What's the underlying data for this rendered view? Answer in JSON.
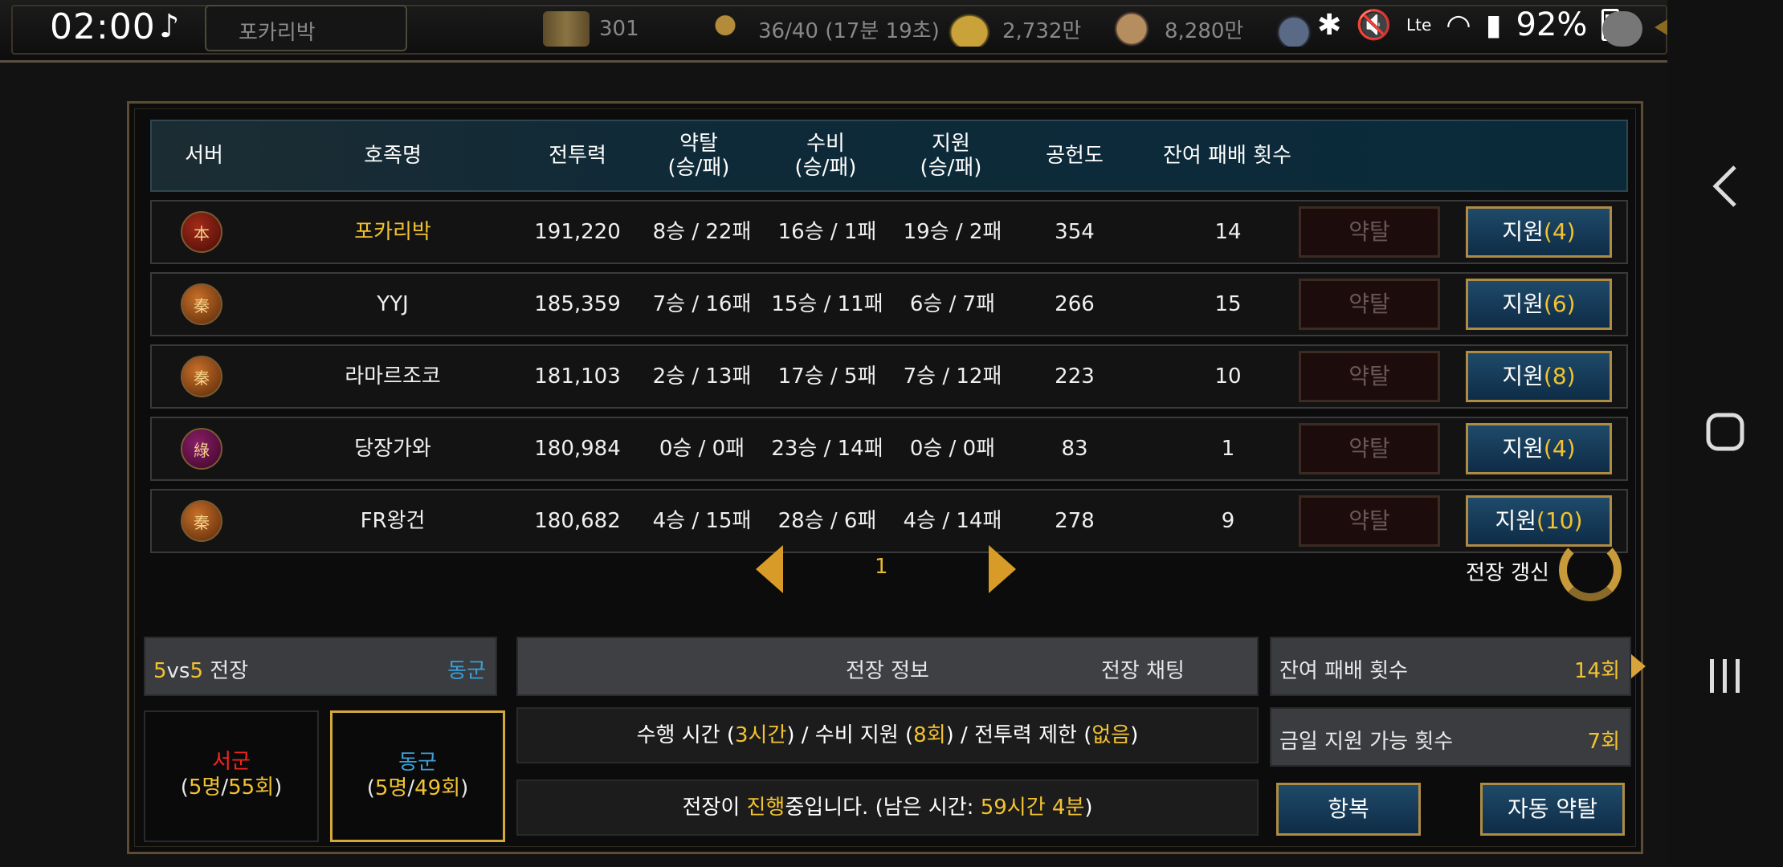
{
  "status": {
    "time": "02:00",
    "music_icon": "music-note-icon",
    "battery": "92%"
  },
  "topbar": {
    "player_name": "포카리박",
    "resources": [
      {
        "icon": "scroll-icon",
        "value": "301"
      },
      {
        "icon": "runner-icon",
        "value": "36/40 (17분 19초)"
      },
      {
        "icon": "gold-icon",
        "value": "2,732만"
      },
      {
        "icon": "food-icon",
        "value": "8,280만"
      }
    ]
  },
  "table": {
    "headers": {
      "server": "서버",
      "clan": "호족명",
      "power": "전투력",
      "raid_top": "약탈",
      "raid_bot": "(승/패)",
      "defend_top": "수비",
      "defend_bot": "(승/패)",
      "support_top": "지원",
      "support_bot": "(승/패)",
      "contribution": "공헌도",
      "remaining": "잔여 패배 횟수"
    },
    "raid_label": "약탈",
    "support_label": "지원",
    "rows": [
      {
        "emblem": "本",
        "emblem_color": "red",
        "name": "포카리박",
        "highlight": true,
        "power": "191,220",
        "raid": "8승 / 22패",
        "defend": "16승 / 1패",
        "support": "19승 / 2패",
        "contribution": "354",
        "remaining": "14",
        "support_count": "(4)"
      },
      {
        "emblem": "秦",
        "emblem_color": "orange",
        "name": "YYJ",
        "highlight": false,
        "power": "185,359",
        "raid": "7승 / 16패",
        "defend": "15승 / 11패",
        "support": "6승 / 7패",
        "contribution": "266",
        "remaining": "15",
        "support_count": "(6)"
      },
      {
        "emblem": "秦",
        "emblem_color": "orange",
        "name": "라마르조코",
        "highlight": false,
        "power": "181,103",
        "raid": "2승 / 13패",
        "defend": "17승 / 5패",
        "support": "7승 / 12패",
        "contribution": "223",
        "remaining": "10",
        "support_count": "(8)"
      },
      {
        "emblem": "綠",
        "emblem_color": "purple",
        "name": "당장가와",
        "highlight": false,
        "power": "180,984",
        "raid": "0승 / 0패",
        "defend": "23승 / 14패",
        "support": "0승 / 0패",
        "contribution": "83",
        "remaining": "1",
        "support_count": "(4)"
      },
      {
        "emblem": "秦",
        "emblem_color": "orange",
        "name": "FR왕건",
        "highlight": false,
        "power": "180,682",
        "raid": "4승 / 15패",
        "defend": "28승 / 6패",
        "support": "4승 / 14패",
        "contribution": "278",
        "remaining": "9",
        "support_count": "(10)"
      }
    ]
  },
  "pager": {
    "page": "1",
    "refresh_label": "전장 갱신"
  },
  "bottom": {
    "mode": {
      "five_a": "5",
      "vs": "vs",
      "five_b": "5",
      "label": " 전장",
      "side": "동군"
    },
    "battle_info": "전장 정보",
    "battle_chat": "전장 채팅",
    "remaining_losses": {
      "label": "잔여 패배 횟수",
      "value": "14회"
    },
    "daily_support": {
      "label": "금일 지원 가능 횟수",
      "value": "7회"
    },
    "west": {
      "name": "서군",
      "open": "(",
      "members": "5명",
      "slash": "/",
      "count": "55회",
      "close": ")"
    },
    "east": {
      "name": "동군",
      "open": "(",
      "members": "5명",
      "slash": "/",
      "count": "49회",
      "close": ")"
    },
    "conditions": {
      "t1": "수행 시간 (",
      "v1": "3시간",
      "t2": ") / 수비 지원 (",
      "v2": "8회",
      "t3": ") / 전투력 제한 (",
      "v3": "없음",
      "t4": ")"
    },
    "progress": {
      "t1": "전장이 ",
      "v1": "진행",
      "t2": "중입니다. (남은 시간: ",
      "v2": "59시간 4분",
      "t3": ")"
    },
    "surrender": "항복",
    "auto_raid": "자동 약탈"
  },
  "colors": {
    "accent_gold": "#f2c230",
    "east_blue": "#3aa0d8",
    "west_red": "#f0261e",
    "button_blue": "#1f4a6a"
  }
}
